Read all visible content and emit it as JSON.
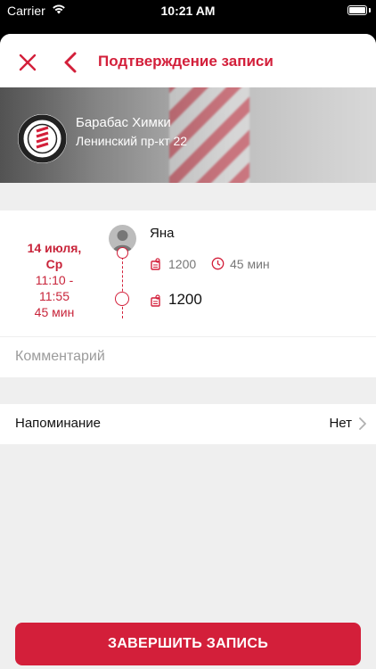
{
  "status_bar": {
    "carrier": "Carrier",
    "time": "10:21 AM"
  },
  "nav": {
    "title": "Подтверждение записи",
    "close_icon": "close-icon",
    "back_icon": "chevron-left-icon"
  },
  "shop": {
    "name": "Барабас Химки",
    "address": "Ленинский пр-кт 22"
  },
  "booking": {
    "date": {
      "day": "14 июля,",
      "weekday": "Ср",
      "time_start": "11:10 -",
      "time_end": "11:55",
      "duration": "45 мин"
    },
    "master": "Яна",
    "service_price": "1200",
    "service_duration": "45 мин",
    "total_price": "1200"
  },
  "comment": {
    "placeholder": "Комментарий"
  },
  "reminder": {
    "label": "Напоминание",
    "value": "Нет"
  },
  "finish_button": {
    "label": "ЗАВЕРШИТЬ ЗАПИСЬ"
  },
  "colors": {
    "accent": "#d31f3a",
    "background": "#efefef",
    "muted_text": "#777777"
  }
}
